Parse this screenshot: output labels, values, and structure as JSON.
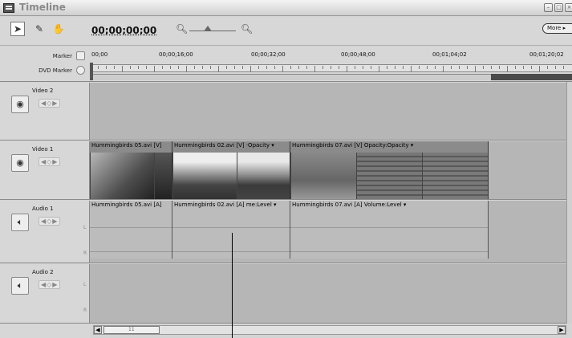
{
  "window": {
    "title": "Timeline"
  },
  "toolbar": {
    "timecode": "00;00;00;00",
    "more_label": "More ▸"
  },
  "ruler": {
    "marker_label": "Marker",
    "dvd_marker_label": "DVD Marker",
    "times": [
      "00;00",
      "00;00;16;00",
      "00;00;32;00",
      "00;00;48;00",
      "00;01;04;02",
      "00;01;20;02"
    ]
  },
  "tracks": {
    "video2": {
      "name": "Video 2"
    },
    "video1": {
      "name": "Video 1",
      "clips": [
        "Hummingbirds 05.avi [V]",
        "Hummingbirds 02.avi [V] ·Opacity ▾",
        "Hummingbirds 07.avi [V] Opacity:Opacity ▾"
      ]
    },
    "audio1": {
      "name": "Audio 1",
      "clips": [
        "Hummingbirds 05.avi [A]",
        "Hummingbirds 02.avi [A] me:Level ▾",
        "Hummingbirds 07.avi [A] Volume:Level ▾"
      ]
    },
    "audio2": {
      "name": "Audio 2"
    }
  },
  "channels": {
    "left": "L",
    "right": "R"
  },
  "scroll": {
    "label": "11"
  },
  "colors": {
    "track_bg": "#b6b6b6",
    "panel_bg": "#d7d7d7",
    "work_area_end": "#4a4a4a"
  }
}
